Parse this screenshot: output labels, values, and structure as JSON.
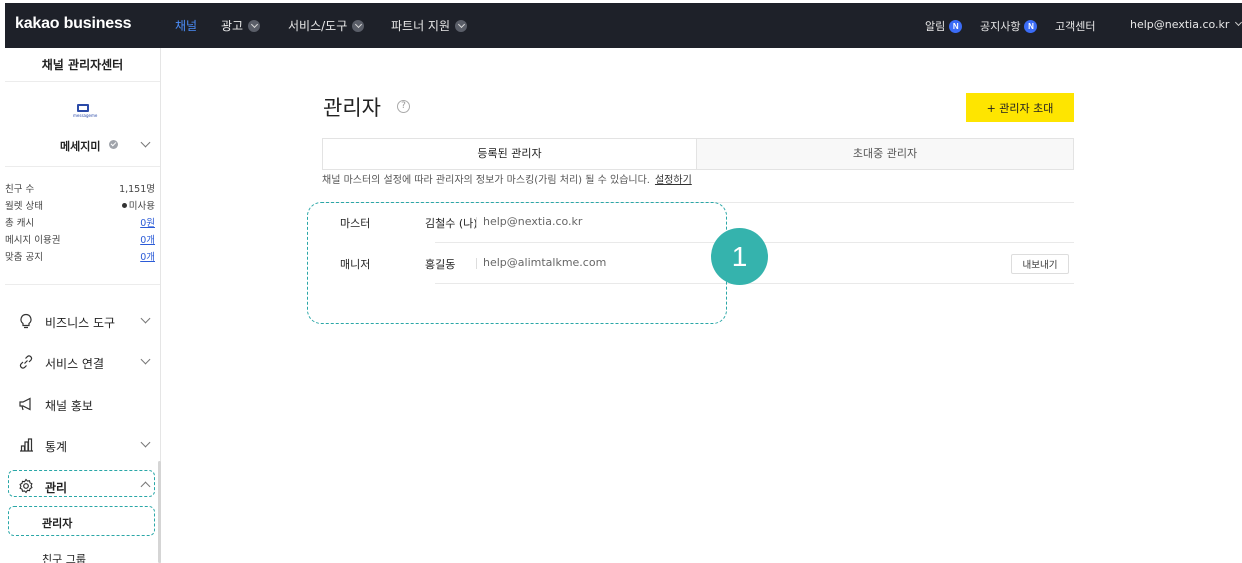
{
  "topbar": {
    "logo": "kakao business",
    "nav": [
      {
        "label": "채널",
        "active": true
      },
      {
        "label": "광고"
      },
      {
        "label": "서비스/도구"
      },
      {
        "label": "파트너 지원"
      }
    ],
    "alerts_label": "알림",
    "notice_label": "공지사항",
    "new_badge": "N",
    "support_label": "고객센터",
    "account_email": "help@nextia.co.kr"
  },
  "sidebar": {
    "title": "채널 관리자센터",
    "channel_logo_text": "messageme",
    "channel_name": "메세지미",
    "stats": [
      {
        "key": "친구 수",
        "value": "1,151명"
      },
      {
        "key": "월렛 상태",
        "value": "미사용"
      },
      {
        "key": "총 캐시",
        "value": "0원"
      },
      {
        "key": "메시지 이용권",
        "value": "0개"
      },
      {
        "key": "맞춤 공지",
        "value": "0개"
      }
    ],
    "menu": [
      {
        "label": "비즈니스 도구",
        "icon": "lightbulb-icon"
      },
      {
        "label": "서비스 연결",
        "icon": "link-icon"
      },
      {
        "label": "채널 홍보",
        "icon": "megaphone-icon"
      },
      {
        "label": "통계",
        "icon": "bar-chart-icon"
      },
      {
        "label": "관리",
        "icon": "gear-icon"
      }
    ],
    "sub_items": [
      "관리자",
      "친구 그룹"
    ]
  },
  "main": {
    "title": "관리자",
    "invite_button": "+ 관리자 초대",
    "tabs": [
      "등록된 관리자",
      "초대중 관리자"
    ],
    "notice": "채널 마스터의 설정에 따라 관리자의 정보가 마스킹(가림 처리) 될 수 있습니다.",
    "notice_link": "설정하기",
    "rows": [
      {
        "role": "마스터",
        "name": "김철수 (나)",
        "email": "help@nextia.co.kr"
      },
      {
        "role": "매니저",
        "name": "홍길동",
        "email": "help@alimtalkme.com",
        "action": "내보내기"
      }
    ],
    "step_badge": "1"
  },
  "colors": {
    "topbar_bg": "#1e2129",
    "active_nav": "#4b8df8",
    "invite_button": "#fee500",
    "highlight_dash": "#2aa7a7",
    "step_badge": "#35b3ad"
  }
}
